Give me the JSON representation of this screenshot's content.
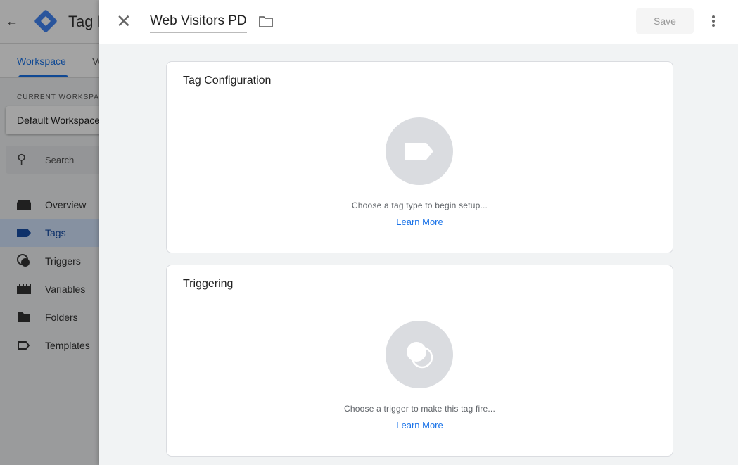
{
  "app": {
    "title": "Tag Manager",
    "tabs": [
      {
        "label": "Workspace"
      },
      {
        "label": "Versions"
      }
    ],
    "current_workspace_label": "CURRENT WORKSPACE",
    "workspace": "Default Workspace",
    "search_placeholder": "Search",
    "nav": [
      {
        "label": "Overview",
        "icon": "overview-icon"
      },
      {
        "label": "Tags",
        "icon": "tag-icon",
        "active": true
      },
      {
        "label": "Triggers",
        "icon": "trigger-icon"
      },
      {
        "label": "Variables",
        "icon": "variables-icon"
      },
      {
        "label": "Folders",
        "icon": "folder-icon"
      },
      {
        "label": "Templates",
        "icon": "template-icon"
      }
    ]
  },
  "panel": {
    "tag_name": "Web Visitors PD",
    "save_label": "Save",
    "cards": [
      {
        "title": "Tag Configuration",
        "hint": "Choose a tag type to begin setup...",
        "link": "Learn More"
      },
      {
        "title": "Triggering",
        "hint": "Choose a trigger to make this tag fire...",
        "link": "Learn More"
      }
    ]
  },
  "colors": {
    "accent": "#1a73e8",
    "placeholder_circle": "#dadce0"
  }
}
